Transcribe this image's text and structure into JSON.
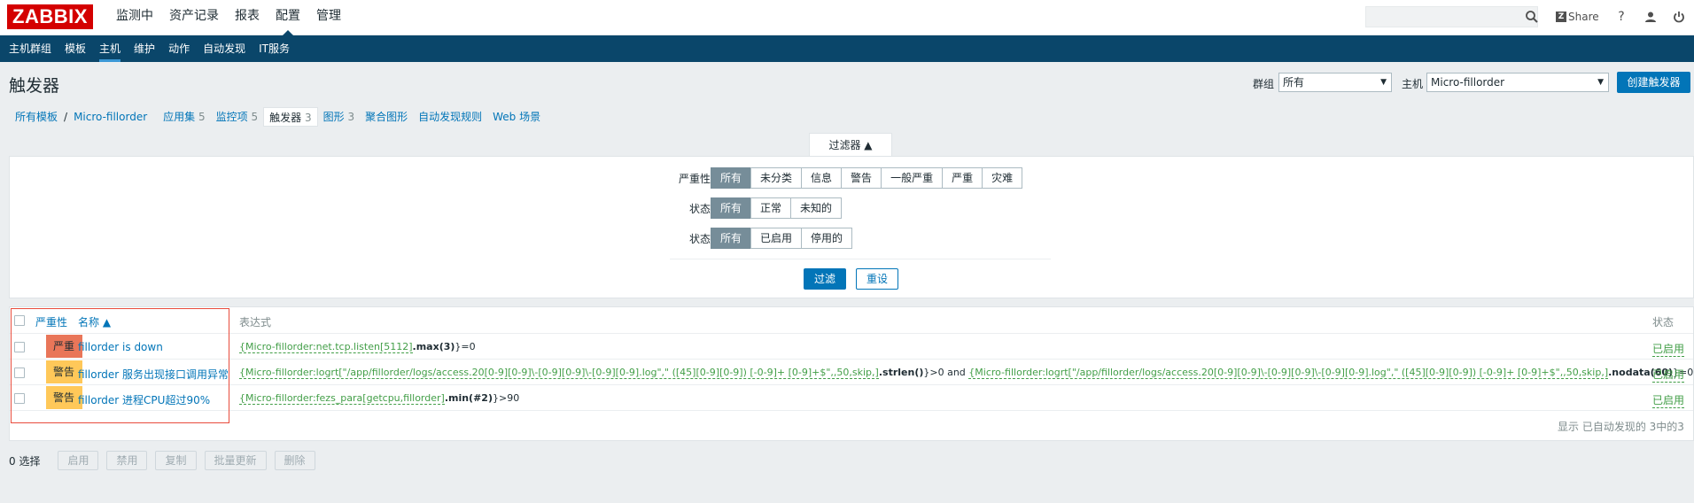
{
  "topbar": {
    "logo": "ZABBIX",
    "menu": [
      "监测中",
      "资产记录",
      "报表",
      "配置",
      "管理"
    ],
    "selected_menu": "配置",
    "search_placeholder": "",
    "share_label": "Share",
    "help_label": "?"
  },
  "submenu": {
    "items": [
      "主机群组",
      "模板",
      "主机",
      "维护",
      "动作",
      "自动发现",
      "IT服务"
    ],
    "selected": "主机"
  },
  "header": {
    "title": "触发器",
    "group_label": "群组",
    "group_value": "所有",
    "host_label": "主机",
    "host_value": "Micro-fillorder",
    "create_button": "创建触发器"
  },
  "breadcrumb": {
    "all_templates": "所有模板",
    "host": "Micro-fillorder",
    "tabs": [
      {
        "label": "应用集",
        "count": "5"
      },
      {
        "label": "监控项",
        "count": "5"
      },
      {
        "label": "触发器",
        "count": "3"
      },
      {
        "label": "图形",
        "count": "3"
      },
      {
        "label": "聚合图形",
        "count": ""
      },
      {
        "label": "自动发现规则",
        "count": ""
      },
      {
        "label": "Web 场景",
        "count": ""
      }
    ]
  },
  "filter": {
    "tab_label": "过滤器 ▲",
    "severity_label": "严重性",
    "severity_options": [
      "所有",
      "未分类",
      "信息",
      "警告",
      "一般严重",
      "严重",
      "灾难"
    ],
    "state_label": "状态",
    "state_options": [
      "所有",
      "正常",
      "未知的"
    ],
    "status_label": "状态",
    "status_options": [
      "所有",
      "已启用",
      "停用的"
    ],
    "apply_button": "过滤",
    "reset_button": "重设"
  },
  "table": {
    "headers": {
      "severity": "严重性",
      "name": "名称 ▲",
      "expression": "表达式",
      "status": "状态"
    },
    "rows": [
      {
        "severity": "严重",
        "severity_color": "#e97659",
        "name": "fillorder is down",
        "expr": [
          {
            "t": "{Micro-fillorder:net.tcp.listen[5112]",
            "s": "g"
          },
          {
            "t": ".max(3)",
            "s": "b"
          },
          {
            "t": "}=0",
            "s": ""
          }
        ],
        "status": "已启用"
      },
      {
        "severity": "警告",
        "severity_color": "#ffc859",
        "name": "fillorder 服务出现接口调用异常",
        "expr": [
          {
            "t": "{Micro-fillorder:logrt[\"/app/fillorder/logs/access.20[0-9][0-9]\\-[0-9][0-9]\\-[0-9][0-9].log\",\" ([45][0-9][0-9]) [-0-9]+ [0-9]+$\",,50,skip,]",
            "s": "g"
          },
          {
            "t": ".strlen()",
            "s": "b"
          },
          {
            "t": "}>0 and ",
            "s": ""
          },
          {
            "t": "{Micro-fillorder:logrt[\"/app/fillorder/logs/access.20[0-9][0-9]\\-[0-9][0-9]\\-[0-9][0-9].log\",\" ([45][0-9][0-9]) [-0-9]+ [0-9]+$\",,50,skip,]",
            "s": "g"
          },
          {
            "t": ".nodata(60)",
            "s": "b"
          },
          {
            "t": "}=0",
            "s": ""
          }
        ],
        "status": "已启用"
      },
      {
        "severity": "警告",
        "severity_color": "#ffc859",
        "name": "fillorder 进程CPU超过90%",
        "expr": [
          {
            "t": "{Micro-fillorder:fezs_para[getcpu,fillorder]",
            "s": "g"
          },
          {
            "t": ".min(#2)",
            "s": "b"
          },
          {
            "t": "}>90",
            "s": ""
          }
        ],
        "status": "已启用"
      }
    ],
    "footer": "显示 已自动发现的 3中的3"
  },
  "bottom": {
    "selected_count": "0 选择",
    "buttons": [
      "启用",
      "禁用",
      "复制",
      "批量更新",
      "删除"
    ]
  }
}
